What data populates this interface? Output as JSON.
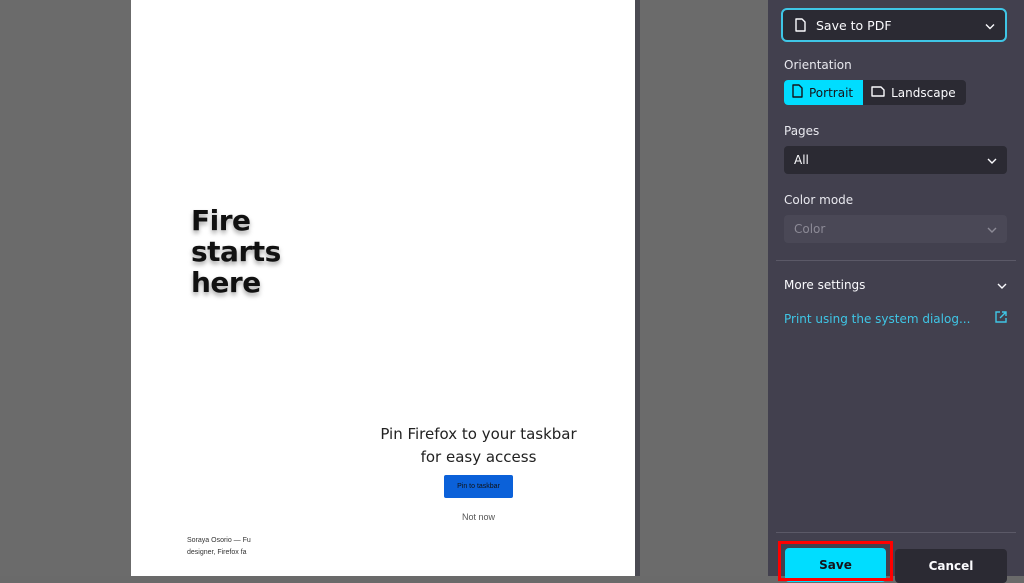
{
  "preview": {
    "hero_lines": [
      "Fire",
      "starts",
      "here"
    ],
    "pin_title_line1": "Pin Firefox to your taskbar",
    "pin_title_line2": "for easy access",
    "pin_button": "Pin to taskbar",
    "not_now": "Not now",
    "byline_line1": "Soraya Osorio — Fu",
    "byline_line2": "designer, Firefox fa"
  },
  "panel": {
    "destination": {
      "value": "Save to PDF",
      "icon": "document-icon"
    },
    "orientation": {
      "label": "Orientation",
      "options": [
        {
          "label": "Portrait",
          "icon": "portrait-page-icon",
          "selected": true
        },
        {
          "label": "Landscape",
          "icon": "landscape-page-icon",
          "selected": false
        }
      ]
    },
    "pages": {
      "label": "Pages",
      "value": "All"
    },
    "color_mode": {
      "label": "Color mode",
      "value": "Color",
      "disabled": true
    },
    "more_settings": "More settings",
    "system_dialog_link": "Print using the system dialog...",
    "buttons": {
      "save": "Save",
      "cancel": "Cancel"
    },
    "colors": {
      "accent": "#00ddff",
      "panel_bg": "#42404e",
      "field_bg": "#2b2a33",
      "link": "#3fc6e6",
      "highlight": "#ff0000"
    }
  }
}
